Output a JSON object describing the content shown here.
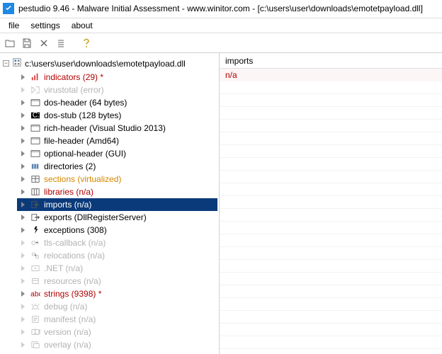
{
  "title": "pestudio 9.46 - Malware Initial Assessment - www.winitor.com - [c:\\users\\user\\downloads\\emotetpayload.dll]",
  "menu": {
    "file": "file",
    "settings": "settings",
    "about": "about"
  },
  "root_path": "c:\\users\\user\\downloads\\emotetpayload.dll",
  "tree": [
    {
      "label": "indicators (29) *",
      "color": "red",
      "icon": "indicators"
    },
    {
      "label": "virustotal (error)",
      "color": "gray",
      "icon": "virustotal"
    },
    {
      "label": "dos-header (64 bytes)",
      "color": "black",
      "icon": "header"
    },
    {
      "label": "dos-stub (128 bytes)",
      "color": "black",
      "icon": "dosstub"
    },
    {
      "label": "rich-header (Visual Studio 2013)",
      "color": "black",
      "icon": "header"
    },
    {
      "label": "file-header (Amd64)",
      "color": "black",
      "icon": "header"
    },
    {
      "label": "optional-header (GUI)",
      "color": "black",
      "icon": "header"
    },
    {
      "label": "directories (2)",
      "color": "black",
      "icon": "directories"
    },
    {
      "label": "sections (virtualized)",
      "color": "orange",
      "icon": "sections"
    },
    {
      "label": "libraries (n/a)",
      "color": "red",
      "icon": "libraries"
    },
    {
      "label": "imports (n/a)",
      "color": "red",
      "icon": "imports",
      "selected": true
    },
    {
      "label": "exports (DllRegisterServer)",
      "color": "black",
      "icon": "exports"
    },
    {
      "label": "exceptions (308)",
      "color": "black",
      "icon": "exceptions"
    },
    {
      "label": "tls-callback (n/a)",
      "color": "gray",
      "icon": "tls"
    },
    {
      "label": "relocations (n/a)",
      "color": "gray",
      "icon": "reloc"
    },
    {
      "label": ".NET (n/a)",
      "color": "gray",
      "icon": "dotnet"
    },
    {
      "label": "resources (n/a)",
      "color": "gray",
      "icon": "resources"
    },
    {
      "label": "strings (9398) *",
      "color": "red",
      "icon": "strings"
    },
    {
      "label": "debug (n/a)",
      "color": "gray",
      "icon": "debug"
    },
    {
      "label": "manifest (n/a)",
      "color": "gray",
      "icon": "manifest"
    },
    {
      "label": "version (n/a)",
      "color": "gray",
      "icon": "version"
    },
    {
      "label": "overlay (n/a)",
      "color": "gray",
      "icon": "overlay"
    }
  ],
  "detail": {
    "header": "imports",
    "value": "n/a"
  }
}
